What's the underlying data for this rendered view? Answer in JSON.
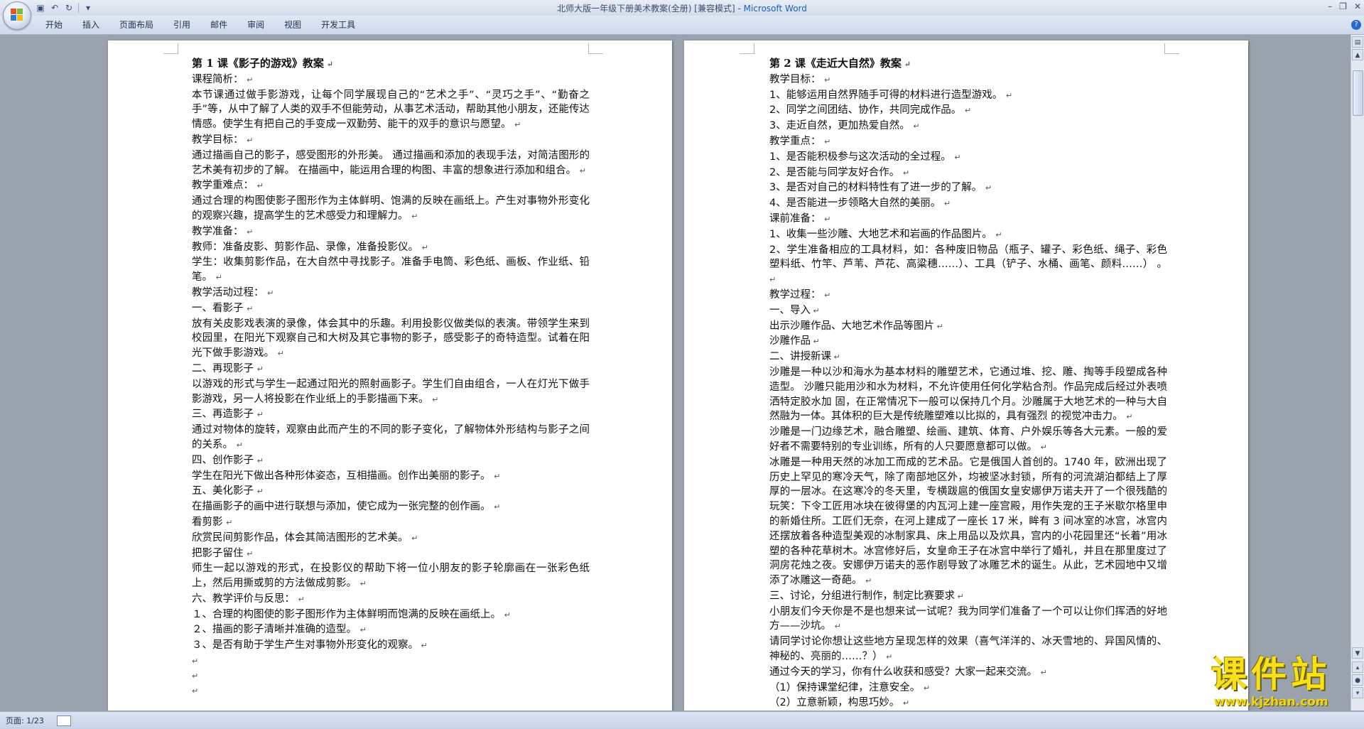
{
  "window": {
    "title_doc": "北师大版一年级下册美术教案(全册) [兼容模式] -",
    "title_app": "Microsoft Word"
  },
  "ribbon": {
    "tabs": [
      "开始",
      "插入",
      "页面布局",
      "引用",
      "邮件",
      "审阅",
      "视图",
      "开发工具"
    ]
  },
  "status": {
    "page": "页面: 1/23"
  },
  "colors": {
    "accent": "#1f5fb8",
    "ribbon": "#dfe7f3",
    "page_bg": "#9aa3ad"
  },
  "icons": [
    "office-button-icon",
    "save-icon",
    "undo-icon",
    "redo-icon",
    "customize-icon",
    "minimize-icon",
    "restore-icon",
    "close-icon",
    "help-icon"
  ],
  "page1": [
    {
      "t": "第 1 课《影子的游戏》教案",
      "h": true
    },
    {
      "t": "课程简析：  "
    },
    {
      "t": "本节课通过做手影游戏，让每个同学展现自己的“艺术之手”、“灵巧之手”、“勤奋之手”等，从中了解了人类的双手不但能劳动，从事艺术活动，帮助其他小朋友，还能传达情感。使学生有把自己的手变成一双勤劳、能干的双手的意识与愿望。    "
    },
    {
      "t": "教学目标：  "
    },
    {
      "t": "通过描画自己的影子，感受图形的外形美。  通过描画和添加的表现手法，对简洁图形的艺术美有初步的了解。  在描画中，能运用合理的构图、丰富的想象进行添加和组合。    "
    },
    {
      "t": "教学重难点：  "
    },
    {
      "t": "通过合理的构图使影子图形作为主体鲜明、饱满的反映在画纸上。产生对事物外形变化的观察兴趣，提高学生的艺术感受力和理解力。    "
    },
    {
      "t": "教学准备：    "
    },
    {
      "t": "教师：准备皮影、剪影作品、录像，准备投影仪。    "
    },
    {
      "t": "学生：收集剪影作品，在大自然中寻找影子。准备手电筒、彩色纸、画板、作业纸、铅笔。    "
    },
    {
      "t": "教学活动过程：    "
    },
    {
      "t": "一、看影子        "
    },
    {
      "t": "放有关皮影戏表演的录像，体会其中的乐趣。利用投影仪做类似的表演。带领学生来到校园里，在阳光下观察自己和大树及其它事物的影子，感受影子的奇特造型。试着在阳光下做手影游戏。     "
    },
    {
      "t": "二、再现影子    "
    },
    {
      "t": "以游戏的形式与学生一起通过阳光的照射画影子。学生们自由组合，一人在灯光下做手影游戏，另一人将投影在作业纸上的手影描画下来。     "
    },
    {
      "t": "三、再造影子    "
    },
    {
      "t": "通过对物体的旋转，观察由此而产生的不同的影子变化，了解物体外形结构与影子之间的关系。     "
    },
    {
      "t": "四、创作影子    "
    },
    {
      "t": "学生在阳光下做出各种形体姿态，互相描画。创作出美丽的影子。     "
    },
    {
      "t": "五、美化影子  "
    },
    {
      "t": "在描画影子的画中进行联想与添加，使它成为一张完整的创作画。     "
    },
    {
      "t": "看剪影        "
    },
    {
      "t": "欣赏民间剪影作品，体会其简洁图形的艺术美。  "
    },
    {
      "t": "把影子留住    "
    },
    {
      "t": "师生一起以游戏的形式，在投影仪的帮助下将一位小朋友的影子轮廓画在一张彩色纸上，然后用撕或剪的方法做成剪影。     "
    },
    {
      "t": "六、教学评价与反思：    "
    },
    {
      "t": "１、合理的构图使的影子图形作为主体鲜明而饱满的反映在画纸上。  "
    },
    {
      "t": "２、描画的影子清晰并准确的造型。    "
    },
    {
      "t": "３、是否有助于学生产生对事物外形变化的观察。"
    },
    {
      "t": "",
      "e": true
    },
    {
      "t": "",
      "e": true
    },
    {
      "t": "",
      "e": true
    }
  ],
  "page2": [
    {
      "t": "第 2 课《走近大自然》教案",
      "h": true
    },
    {
      "t": "教学目标：  "
    },
    {
      "t": "1、能够运用自然界随手可得的材料进行造型游戏。  "
    },
    {
      "t": "2、同学之间团结、协作，共同完成作品。  "
    },
    {
      "t": "3、走近自然，更加热爱自然。  "
    },
    {
      "t": "教学重点：  "
    },
    {
      "t": "1、是否能积极参与这次活动的全过程。  "
    },
    {
      "t": "2、是否能与同学友好合作。  "
    },
    {
      "t": "3、是否对自己的材料特性有了进一步的了解。  "
    },
    {
      "t": "4、是否能进一步领略大自然的美丽。  "
    },
    {
      "t": "课前准备：  "
    },
    {
      "t": "1、收集一些沙雕、大地艺术和岩画的作品图片。  "
    },
    {
      "t": "2、学生准备相应的工具材料，如：各种废旧物品（瓶子、罐子、彩色纸、绳子、彩色塑料纸、竹竿、芦苇、芦花、高粱穗……）、工具（铲子、水桶、画笔、颜料……）  。  "
    },
    {
      "t": "教学过程：  "
    },
    {
      "t": "一、导入"
    },
    {
      "t": "出示沙雕作品、大地艺术作品等图片"
    },
    {
      "t": "沙雕作品"
    },
    {
      "t": "二、讲授新课"
    },
    {
      "t": "沙雕是一种以沙和海水为基本材料的雕塑艺术，它通过堆、挖、雕、掏等手段塑成各种造型。  沙雕只能用沙和水为材料，不允许使用任何化学粘合剂。作品完成后经过外表喷洒特定胶水加  固，在正常情况下一般可以保持几个月。沙雕属于大地艺术的一种与大自然融为一体。其体积的巨大是传统雕塑难以比拟的，具有强烈  的视觉冲击力。  "
    },
    {
      "t": "沙雕是一门边缘艺术，融合雕塑、绘画、建筑、体育、户外娱乐等各大元素。一般的爱好者不需要特别的专业训练，所有的人只要愿意都可以做。  "
    },
    {
      "t": "冰雕是一种用天然的冰加工而成的艺术品。它是俄国人首创的。1740 年，欧洲出现了历史上罕见的寒冷天气，除了南部地区外，均被坚冰封锁，所有的河流湖泊都结上了厚厚的一层冰。在这寒冷的冬天里，专横跋扈的俄国女皇安娜伊万诺夫开了一个很残酷的玩笑：下令工匠用冰块在彼得堡的内瓦河上建一座宫殿，用作失宠的王子米歇尔格里申的新婚住所。工匠们无奈，在河上建成了一座长 17 米，眸有 3 间冰室的冰宫，冰宫内还摆放着各种造型美观的冰制家具、床上用品以及炊具，宫内的小花园里还“长着”用冰塑的各种花草树木。冰宫修好后，女皇命王子在冰宫中举行了婚礼，并且在那里度过了洞房花烛之夜。安娜伊万诺夫的恶作剧导致了冰雕艺术的诞生。从此，艺术园地中又增添了冰雕这一奇葩。  "
    },
    {
      "t": "三、讨论，分组进行制作，制定比赛要求"
    },
    {
      "t": "小朋友们今天你是不是也想来试一试呢？我为同学们准备了一个可以让你们挥洒的好地方——沙坑。  "
    },
    {
      "t": "请同学讨论你想让这些地方呈现怎样的效果（喜气洋洋的、冰天雪地的、异国风情的、神秘的、亮丽的……？）  "
    },
    {
      "t": "通过今天的学习，你有什么收获和感受？大家一起来交流。  "
    },
    {
      "t": "（1）保持课堂纪律，注意安全。  "
    },
    {
      "t": "（2）立意新颖，构思巧妙。  "
    }
  ],
  "watermark": {
    "logo": "课件站",
    "url": "www.kjzhan.com"
  }
}
